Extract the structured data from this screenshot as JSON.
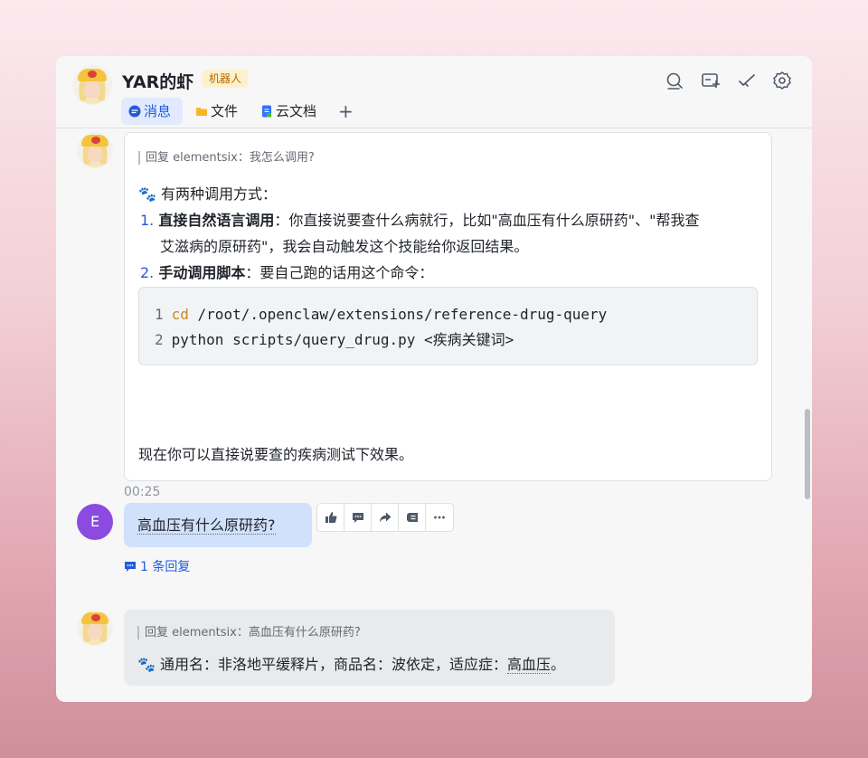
{
  "header": {
    "title": "YAR的虾",
    "tag": "机器人",
    "tabs": [
      {
        "label": "消息",
        "icon": "chat-bubble-icon"
      },
      {
        "label": "文件",
        "icon": "folder-icon"
      },
      {
        "label": "云文档",
        "icon": "doc-icon"
      }
    ],
    "add_tab_label": "+",
    "icons": [
      "search-icon",
      "add-window-icon",
      "check-icon",
      "settings-icon"
    ]
  },
  "messages": {
    "bot_reply_1": {
      "quote": "回复 elementsix：我怎么调用?",
      "intro": "🐾 有两种调用方式：",
      "item1_num": "1.",
      "item1_bold": "直接自然语言调用",
      "item1_rest": "：你直接说要查什么病就行，比如\"高血压有什么原研药\"、\"帮我查",
      "item1_cont": "艾滋病的原研药\"，我会自动触发这个技能给你返回结果。",
      "item2_num": "2.",
      "item2_bold": "手动调用脚本",
      "item2_rest": "：要自己跑的话用这个命令：",
      "code": [
        {
          "ln": "1",
          "kw": "cd",
          "rest": " /root/.openclaw/extensions/reference-drug-query"
        },
        {
          "ln": "2",
          "kw": "",
          "rest": "python scripts/query_drug.py <疾病关键词>"
        }
      ],
      "footer": "现在你可以直接说要查的疾病测试下效果。"
    },
    "timestamp": "00:25",
    "user_avatar_letter": "E",
    "user_message": "高血压有什么原研药?",
    "reply_count": "1 条回复",
    "bot_reply_2": {
      "quote": "回复 elementsix：高血压有什么原研药?",
      "prefix": "🐾 通用名：非洛地平缓释片，商品名：波依定，适应症：",
      "highlight": "高血压",
      "suffix": "。"
    }
  },
  "colors": {
    "accent": "#245bdb",
    "user_bubble": "#d1e0fb",
    "bot_tag_bg": "#fdf1cc",
    "bot_tag_text": "#b26a00",
    "user_avatar": "#8b4be0"
  }
}
